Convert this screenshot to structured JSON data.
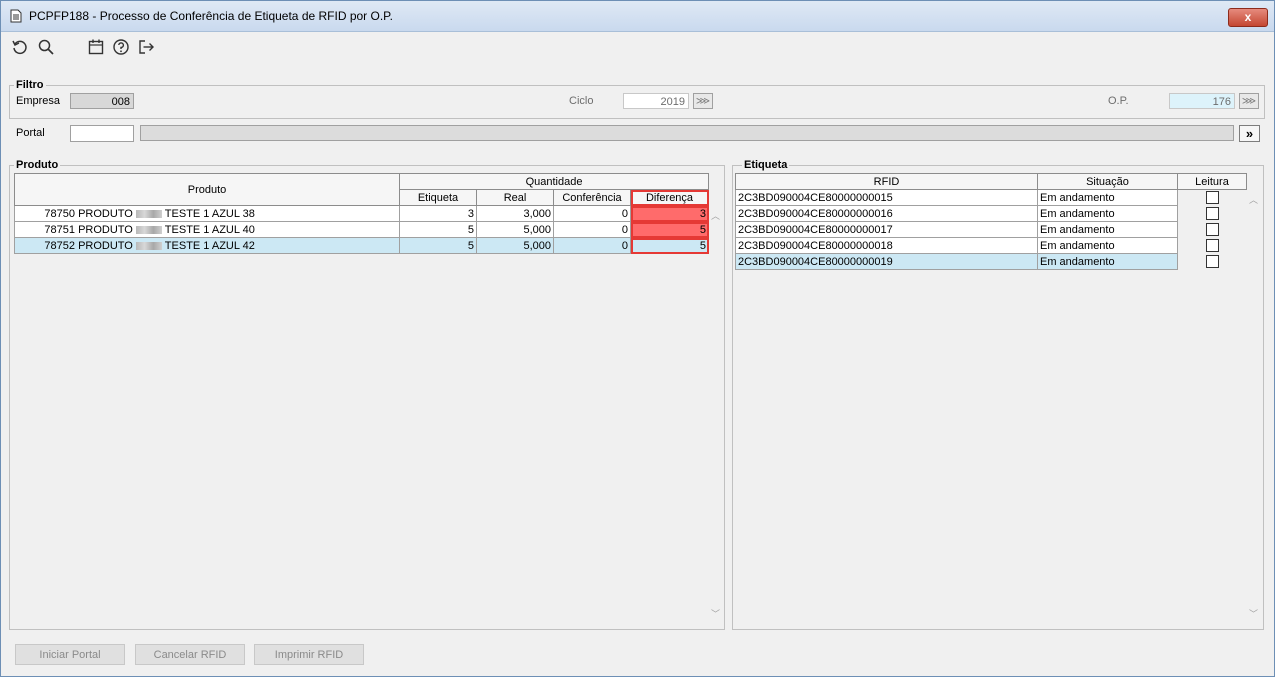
{
  "window": {
    "title": "PCPFP188 - Processo de Conferência de Etiqueta de RFID por O.P.",
    "close_label": "x"
  },
  "toolbar": {
    "icons": [
      "refresh-icon",
      "search-icon",
      "calendar-icon",
      "help-icon",
      "exit-icon"
    ]
  },
  "filtro": {
    "section": "Filtro",
    "empresa_label": "Empresa",
    "empresa_value": "008",
    "ciclo_label": "Ciclo",
    "ciclo_value": "2019",
    "op_label": "O.P.",
    "op_value": "176",
    "portal_label": "Portal",
    "portal_value": "",
    "portal_button": "»"
  },
  "produto": {
    "section": "Produto",
    "headers": {
      "produto": "Produto",
      "quantidade": "Quantidade",
      "etiqueta": "Etiqueta",
      "real": "Real",
      "conferencia": "Conferência",
      "diferenca": "Diferença"
    },
    "rows": [
      {
        "code": "78750",
        "name_prefix": "PRODUTO",
        "name_suffix": "TESTE 1 AZUL 38",
        "etiqueta": "3",
        "real": "3,000",
        "conferencia": "0",
        "diferenca": "3"
      },
      {
        "code": "78751",
        "name_prefix": "PRODUTO",
        "name_suffix": "TESTE 1 AZUL 40",
        "etiqueta": "5",
        "real": "5,000",
        "conferencia": "0",
        "diferenca": "5"
      },
      {
        "code": "78752",
        "name_prefix": "PRODUTO",
        "name_suffix": "TESTE 1 AZUL 42",
        "etiqueta": "5",
        "real": "5,000",
        "conferencia": "0",
        "diferenca": "5"
      }
    ]
  },
  "etiqueta": {
    "section": "Etiqueta",
    "headers": {
      "rfid": "RFID",
      "situacao": "Situação",
      "leitura": "Leitura"
    },
    "rows": [
      {
        "rfid": "2C3BD090004CE80000000015",
        "situacao": "Em andamento"
      },
      {
        "rfid": "2C3BD090004CE80000000016",
        "situacao": "Em andamento"
      },
      {
        "rfid": "2C3BD090004CE80000000017",
        "situacao": "Em andamento"
      },
      {
        "rfid": "2C3BD090004CE80000000018",
        "situacao": "Em andamento"
      },
      {
        "rfid": "2C3BD090004CE80000000019",
        "situacao": "Em andamento"
      }
    ]
  },
  "buttons": {
    "iniciar": "Iniciar Portal",
    "cancelar": "Cancelar RFID",
    "imprimir": "Imprimir RFID"
  },
  "colors": {
    "diff_fill": "#ff6b6b",
    "selected_row": "#cce8f4",
    "highlight_border": "#e53935"
  }
}
